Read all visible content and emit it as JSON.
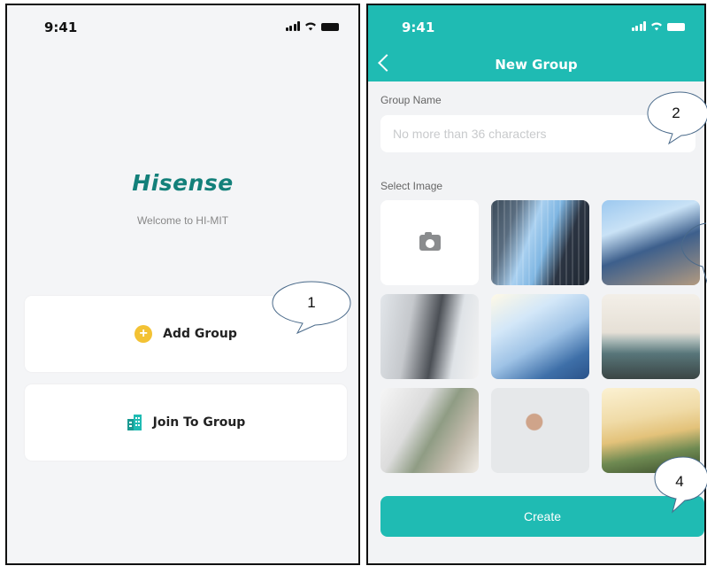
{
  "left_screen": {
    "status_time": "9:41",
    "brand": "Hisense",
    "welcome": "Welcome to HI-MIT",
    "add_group_label": "Add Group",
    "join_group_label": "Join To Group"
  },
  "right_screen": {
    "status_time": "9:41",
    "nav_title": "New Group",
    "group_name_label": "Group Name",
    "group_name_value": "",
    "group_name_placeholder": "No more than 36 characters",
    "select_image_label": "Select Image",
    "image_options": [
      "camera",
      "skyscraper-glass",
      "office-building",
      "laptop-desk",
      "glass-tower-sun",
      "living-room-sofa",
      "desk-lamp-plant",
      "wall-clock-plant",
      "bookshelf-plant"
    ],
    "create_label": "Create"
  },
  "callouts": [
    "1",
    "2",
    "4"
  ],
  "icons": {
    "plus": "+",
    "colors": {
      "teal": "#1fbbb3",
      "brand": "#13807a",
      "accent_yellow": "#f3c234"
    }
  }
}
